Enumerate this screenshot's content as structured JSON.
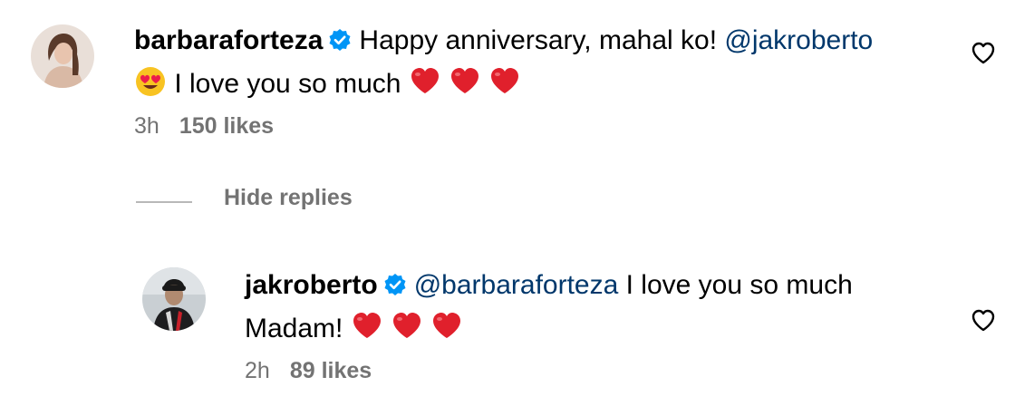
{
  "comments": [
    {
      "username": "barbaraforteza",
      "text_before_mention": "Happy anniversary, mahal ko! ",
      "mention": "@jakroberto",
      "line2_text": " I love you so much ",
      "time": "3h",
      "likes": "150 likes",
      "avatar_icon": "profile-photo",
      "emojis": [
        "smiling-face-with-heart-eyes",
        "red-heart",
        "red-heart",
        "red-heart"
      ]
    }
  ],
  "replies_toggle": {
    "label": "Hide replies"
  },
  "replies": [
    {
      "username": "jakroberto",
      "mention": "@barbaraforteza",
      "text_after_mention": " I love you so much",
      "line2_text": "Madam! ",
      "time": "2h",
      "likes": "89 likes",
      "avatar_icon": "profile-photo",
      "emojis": [
        "red-heart",
        "red-heart",
        "red-heart"
      ]
    }
  ],
  "icons": {
    "verified": "verified-badge-icon",
    "like": "heart-outline-icon"
  },
  "colors": {
    "text": "#000000",
    "mention": "#00376b",
    "meta": "#737373",
    "verified": "#0095f6",
    "heart_emoji": "#e0202c"
  }
}
